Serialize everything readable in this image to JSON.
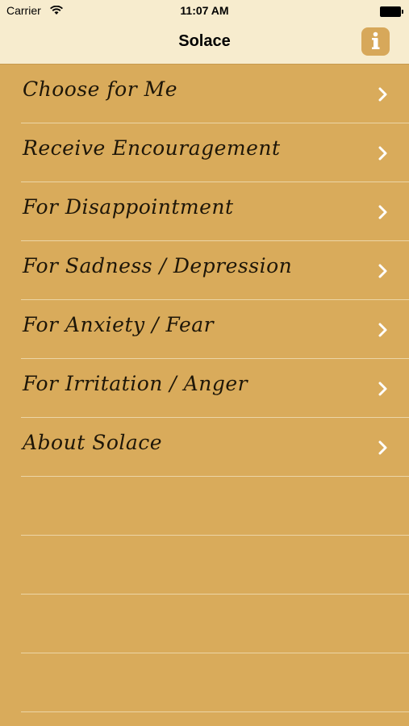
{
  "status_bar": {
    "carrier": "Carrier",
    "time": "11:07 AM"
  },
  "nav": {
    "title": "Solace",
    "info_icon": "info-icon"
  },
  "menu": [
    {
      "label": "Choose for Me"
    },
    {
      "label": "Receive Encouragement"
    },
    {
      "label": "For Disappointment"
    },
    {
      "label": "For Sadness / Depression"
    },
    {
      "label": "For Anxiety / Fear"
    },
    {
      "label": "For Irritation / Anger"
    },
    {
      "label": "About Solace"
    }
  ],
  "colors": {
    "nav_background": "#f7ecce",
    "list_background": "#d9ab5b",
    "info_button": "#d7a85a"
  }
}
